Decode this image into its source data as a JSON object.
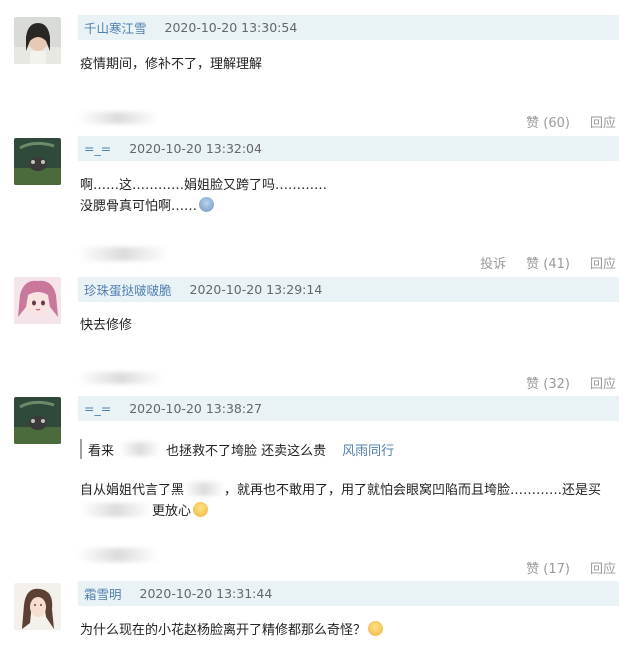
{
  "comments": [
    {
      "user": "千山寒江雪",
      "time": "2020-10-20 13:30:54",
      "text": "疫情期间，修补不了，理解理解",
      "likes": "赞 (60)",
      "reply": "回应"
    },
    {
      "user": "=_=",
      "time": "2020-10-20 13:32:04",
      "text1": "啊……这…………娟姐脸又跨了吗…………",
      "text2": "没腮骨真可怕啊……",
      "report": "投诉",
      "likes": "赞 (41)",
      "reply": "回应"
    },
    {
      "user": "珍珠蛋挞啵啵脆",
      "time": "2020-10-20 13:29:14",
      "text": "快去修修",
      "likes": "赞 (32)",
      "reply": "回应"
    },
    {
      "user": "=_=",
      "time": "2020-10-20 13:38:27",
      "quote_a": "看来",
      "quote_b": "也拯救不了垮脸 还卖这么贵",
      "quote_user": "风雨同行",
      "text1a": "自从娟姐代言了黑",
      "text1b": "，就再也不敢用了，用了就怕会眼窝凹陷而且垮脸…………还是买",
      "text2b": "更放心",
      "likes": "赞 (17)",
      "reply": "回应"
    },
    {
      "user": "霜雪明",
      "time": "2020-10-20 13:31:44",
      "text": "为什么现在的小花赵杨脸离开了精修都那么奇怪？"
    }
  ],
  "colors": {
    "username": "#4f7fae",
    "header_bg": "#e9f2f5",
    "action": "#9a9a9a"
  }
}
